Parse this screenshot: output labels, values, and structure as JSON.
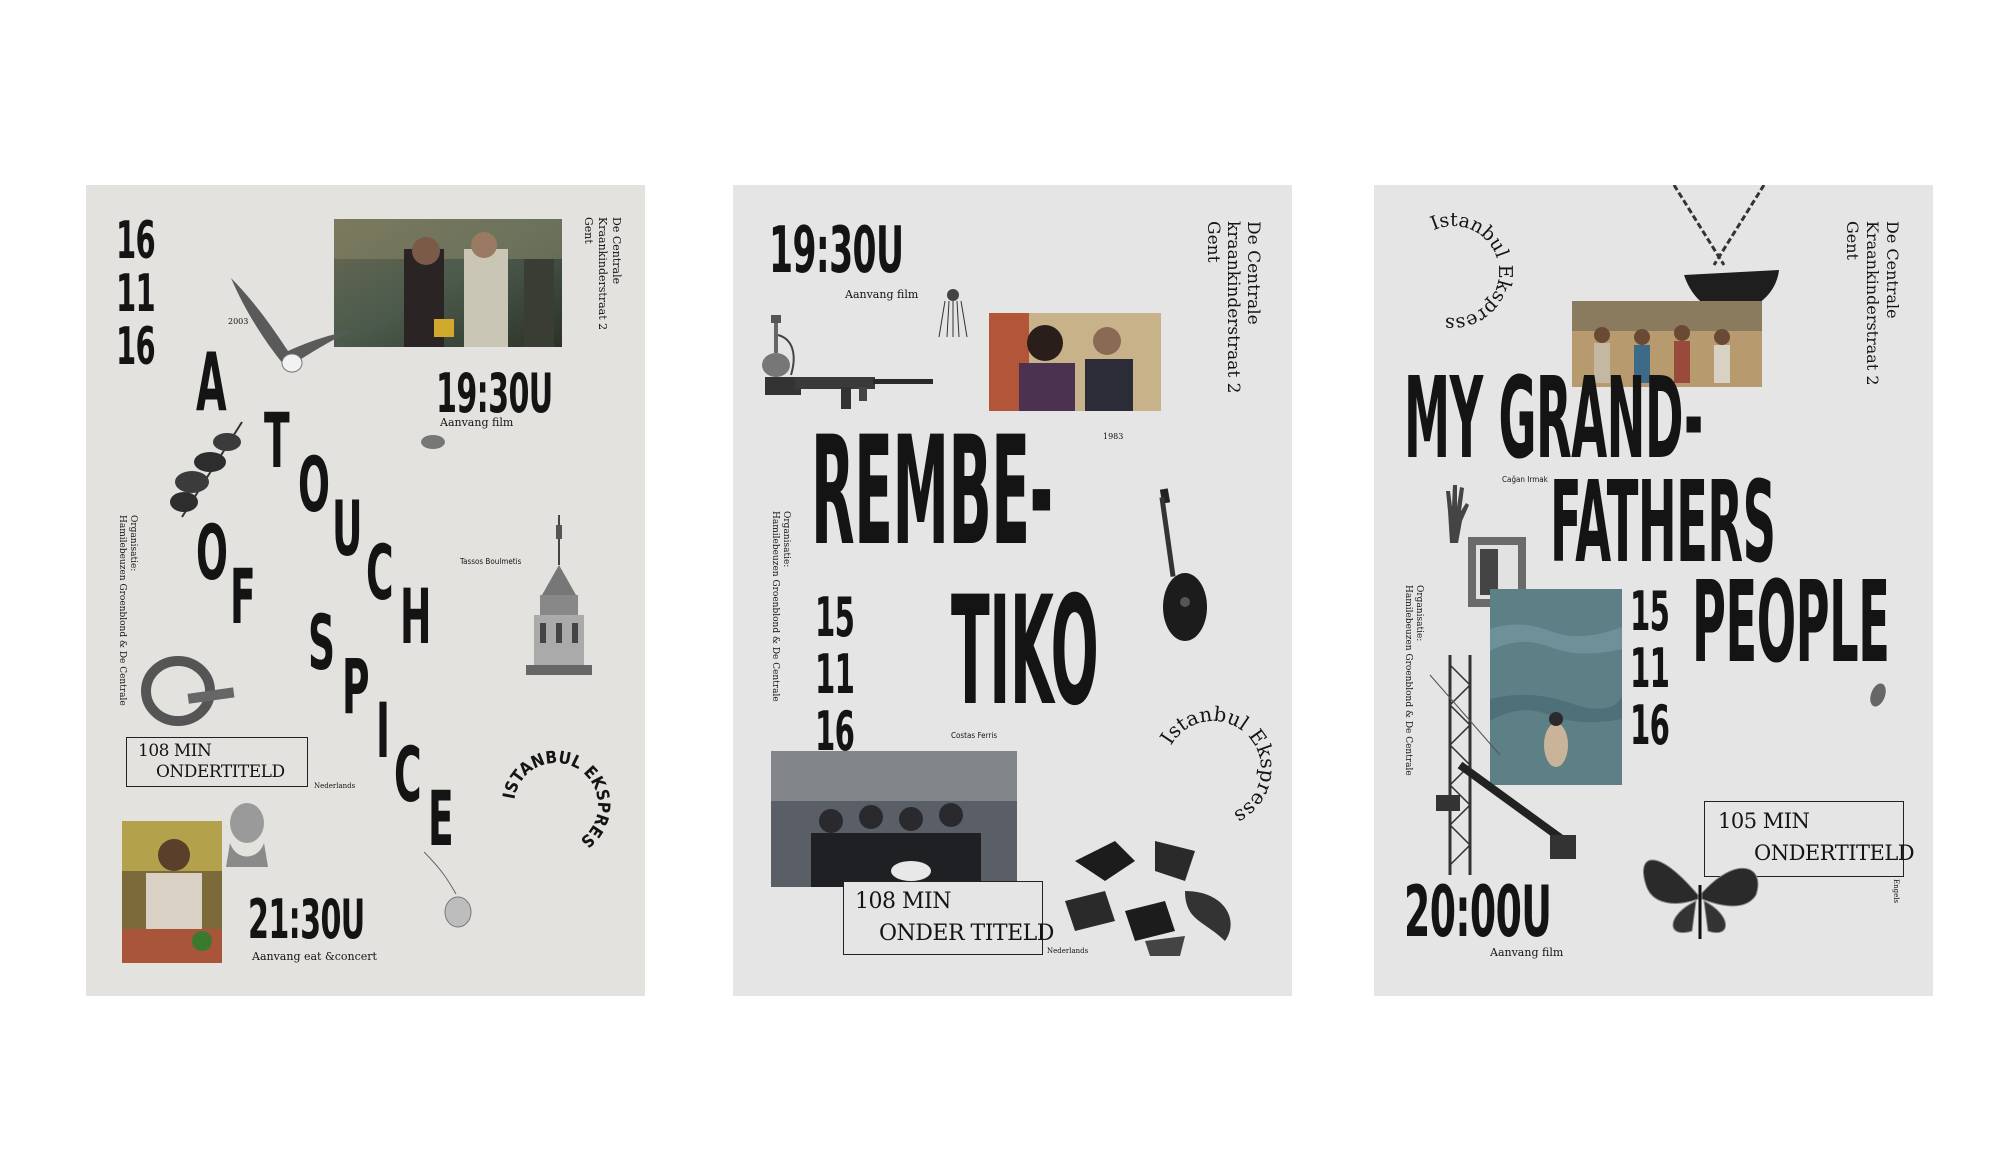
{
  "posters": [
    {
      "date": [
        "16",
        "11",
        "16"
      ],
      "year": "2003",
      "title_words": [
        "A",
        "TOUCH",
        "OF",
        "SPICE"
      ],
      "director": "Tassos Boulmetis",
      "time_film": "19:30U",
      "time_film_caption": "Aanvang film",
      "venue_lines": [
        "De Centrale",
        "Kraankinderstraat 2",
        "Gent"
      ],
      "organiser_lines": [
        "Organisatie:",
        "Hamilebeuzen Groenblond & De Centrale"
      ],
      "duration": "108 MIN",
      "subtitle_label": "ONDERTITELD",
      "subtitle_language": "Nederlands",
      "series_name": "ISTANBUL EKSPRES",
      "time_late": "21:30U",
      "time_late_caption": "Aanvang eat &concert"
    },
    {
      "time_film": "19:30U",
      "time_film_caption": "Aanvang film",
      "year": "1983",
      "title_lines": [
        "REMBE-",
        "TIKO"
      ],
      "director": "Costas Ferris",
      "date": [
        "15",
        "11",
        "16"
      ],
      "venue_lines": [
        "De Centrale",
        "kraankinderstraat 2",
        "Gent"
      ],
      "organiser_lines": [
        "Organisatie:",
        "Hamilebeuzen Groenblond & De Centrale"
      ],
      "duration": "108 MIN",
      "subtitle_label": "ONDER TITELD",
      "subtitle_language": "Nederlands",
      "series_name": "Istanbul Ekspress"
    },
    {
      "series_name": "Istanbul Ekspress",
      "title_lines": [
        "MY GRAND-",
        "FATHERS",
        "PEOPLE"
      ],
      "director": "Cağan Irmak",
      "date": [
        "15",
        "11",
        "16"
      ],
      "venue_lines": [
        "De Centrale",
        "Kraankinderstraat 2",
        "Gent"
      ],
      "organiser_lines": [
        "Organisatie:",
        "Hamilebeuzen Groenblond & De Centrale"
      ],
      "duration": "105 MIN",
      "subtitle_label": "ONDERTITELD",
      "subtitle_language": "Engels",
      "time_film": "20:00U",
      "time_film_caption": "Aanvang film"
    }
  ]
}
